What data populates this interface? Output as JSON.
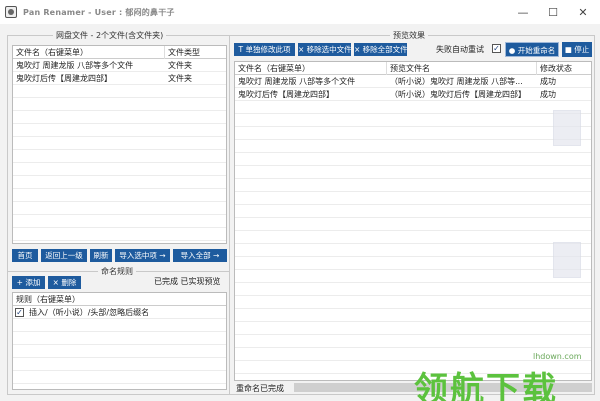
{
  "window": {
    "title": "Pan Renamer - User : 郁闷的鼻干子",
    "min": "—",
    "max": "☐",
    "close": "✕"
  },
  "netdisk": {
    "legend": "网盘文件 - 2个文件(含文件夹)",
    "columns": [
      "文件名（右键菜单）",
      "文件类型"
    ],
    "rows": [
      {
        "name": "鬼吹灯 周建龙版 八部等多个文件",
        "type": "文件夹"
      },
      {
        "name": "鬼吹灯后传【周建龙四部】",
        "type": "文件夹"
      }
    ],
    "buttons": [
      "首页",
      "返回上一级",
      "刷新",
      "导入选中项 →",
      "导入全部 →"
    ]
  },
  "rules": {
    "legend": "命名规则",
    "status": "已完成 已实现预览",
    "add_label": "+ 添加",
    "delete_label": "× 删除",
    "column": "规则（右键菜单）",
    "items": [
      {
        "text": "插入/（听小说）/头部/忽略后缀名",
        "checked": "✓"
      }
    ]
  },
  "preview": {
    "legend": "预览效果",
    "toolbar": {
      "single_label": "T 单独修改此项",
      "remove_selected_label": "× 移除选中文件",
      "remove_all_label": "× 移除全部文件",
      "retry_label": "失败自动重试",
      "retry_checked": "✓",
      "start_label": "● 开始重命名",
      "stop_label": "■ 停止"
    },
    "columns": [
      "文件名（右键菜单）",
      "预览文件名",
      "修改状态"
    ],
    "rows": [
      {
        "name": "鬼吹灯 周建龙版 八部等多个文件",
        "preview": "（听小说）鬼吹灯 周建龙版 八部等...",
        "status": "成功"
      },
      {
        "name": "鬼吹灯后传【周建龙四部】",
        "preview": "（听小说）鬼吹灯后传【周建龙四部】",
        "status": "成功"
      }
    ],
    "status_text": "重命名已完成",
    "progress": 1.0
  },
  "watermark": {
    "text": "领航下载",
    "url": "lhdown.com"
  }
}
